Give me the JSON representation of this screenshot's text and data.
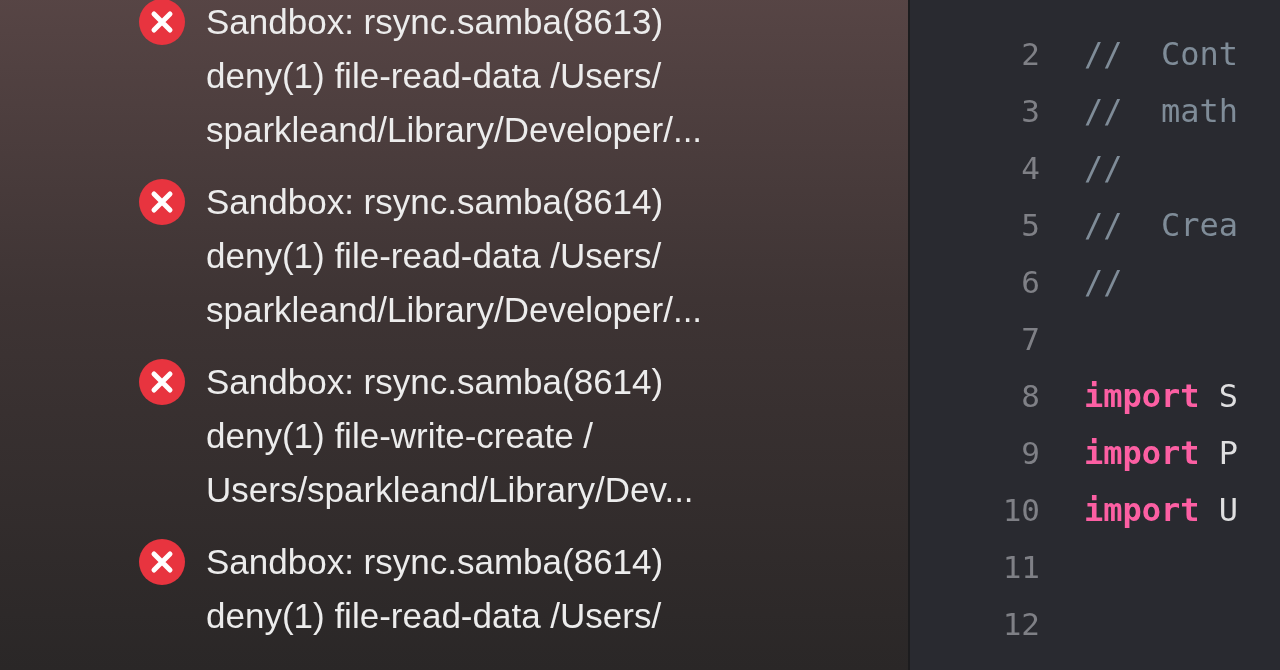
{
  "log": {
    "entries": [
      {
        "lines": [
          "Sandbox: rsync.samba(8613)",
          "deny(1) file-read-data /Users/",
          "sparkleand/Library/Developer/..."
        ]
      },
      {
        "lines": [
          "Sandbox: rsync.samba(8614)",
          "deny(1) file-read-data /Users/",
          "sparkleand/Library/Developer/..."
        ]
      },
      {
        "lines": [
          "Sandbox: rsync.samba(8614)",
          "deny(1) file-write-create /",
          "Users/sparkleand/Library/Dev..."
        ]
      },
      {
        "lines": [
          "Sandbox: rsync.samba(8614)",
          "deny(1) file-read-data /Users/"
        ]
      }
    ]
  },
  "editor": {
    "lines": [
      {
        "number": "2",
        "tokens": [
          {
            "kind": "comment",
            "text": "//  Cont"
          }
        ]
      },
      {
        "number": "3",
        "tokens": [
          {
            "kind": "comment",
            "text": "//  math"
          }
        ]
      },
      {
        "number": "4",
        "tokens": [
          {
            "kind": "comment",
            "text": "//"
          }
        ]
      },
      {
        "number": "5",
        "tokens": [
          {
            "kind": "comment",
            "text": "//  Crea"
          }
        ]
      },
      {
        "number": "6",
        "tokens": [
          {
            "kind": "comment",
            "text": "//"
          }
        ]
      },
      {
        "number": "7"
      },
      {
        "number": "8",
        "tokens": [
          {
            "kind": "keyword",
            "text": "import"
          },
          {
            "kind": "plain",
            "text": " S"
          }
        ]
      },
      {
        "number": "9",
        "tokens": [
          {
            "kind": "keyword",
            "text": "import"
          },
          {
            "kind": "plain",
            "text": " P"
          }
        ]
      },
      {
        "number": "10",
        "tokens": [
          {
            "kind": "keyword",
            "text": "import"
          },
          {
            "kind": "plain",
            "text": " U"
          }
        ]
      },
      {
        "number": "11"
      },
      {
        "number": "12"
      }
    ]
  }
}
